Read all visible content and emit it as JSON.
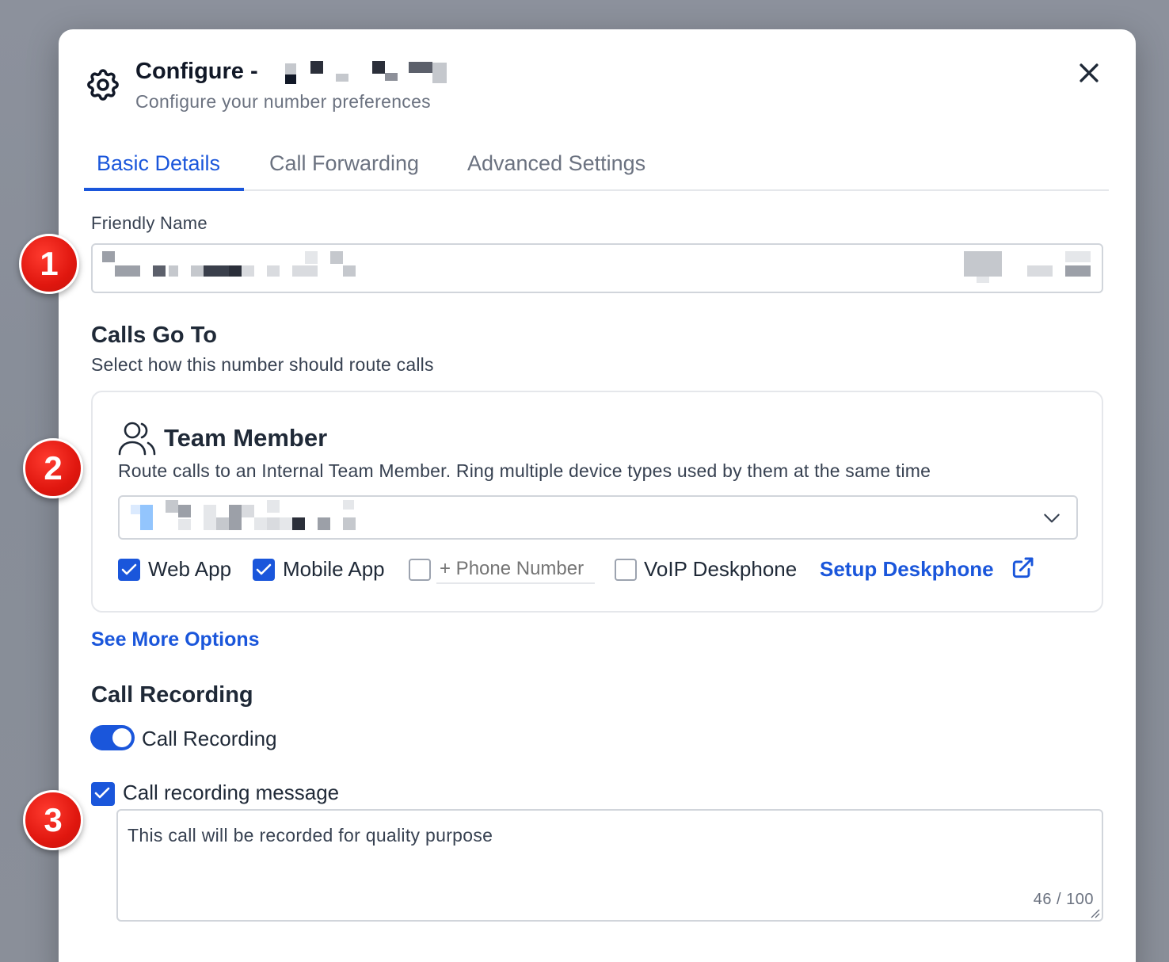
{
  "dialog": {
    "title": "Configure -",
    "subtitle": "Configure your number preferences"
  },
  "tabs": [
    {
      "label": "Basic Details",
      "active": true
    },
    {
      "label": "Call Forwarding",
      "active": false
    },
    {
      "label": "Advanced Settings",
      "active": false
    }
  ],
  "friendly_name": {
    "label": "Friendly Name"
  },
  "calls_go_to": {
    "title": "Calls Go To",
    "subtitle": "Select how this number should route calls",
    "option": {
      "title": "Team Member",
      "description": "Route calls to an Internal Team Member. Ring multiple device types used by them at the same time"
    },
    "devices": {
      "web_app": {
        "label": "Web App",
        "checked": true
      },
      "mobile_app": {
        "label": "Mobile App",
        "checked": true
      },
      "phone_number": {
        "placeholder": "+ Phone Number",
        "checked": false
      },
      "voip": {
        "label": "VoIP Deskphone",
        "checked": false
      },
      "setup_link": "Setup Deskphone"
    }
  },
  "see_more": "See More Options",
  "call_recording": {
    "title": "Call Recording",
    "toggle_label": "Call Recording",
    "toggle_on": true,
    "message_checkbox_label": "Call recording message",
    "message_checked": true,
    "message_value": "This call will be recorded for quality purpose",
    "counter": "46 / 100"
  },
  "annotations": [
    "1",
    "2",
    "3"
  ],
  "colors": {
    "accent": "#1a56db",
    "badge": "#e0170f",
    "overlay": "#8a909b"
  }
}
